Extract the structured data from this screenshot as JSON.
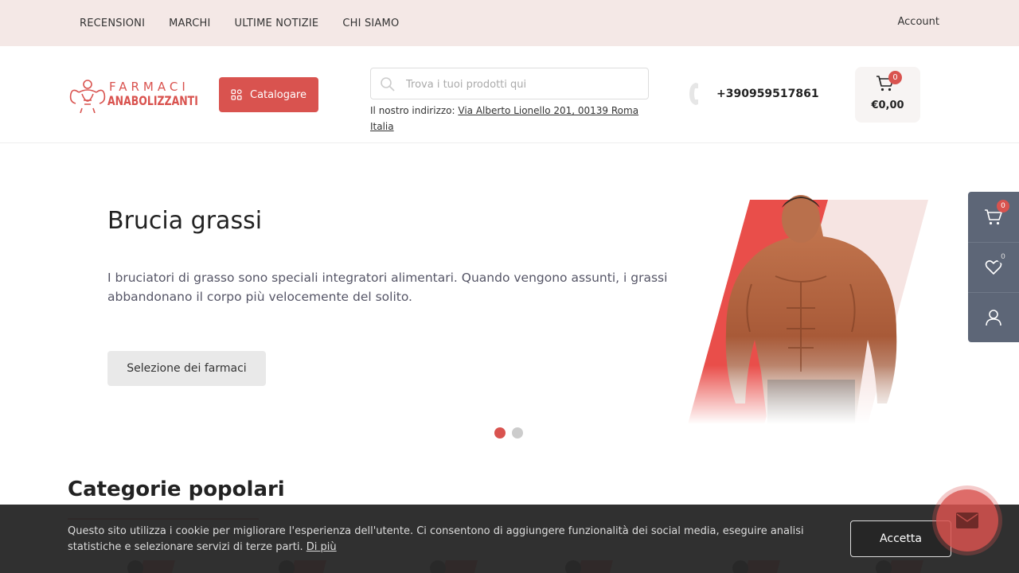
{
  "topnav": {
    "items": [
      "RECENSIONI",
      "MARCHI",
      "ULTIME NOTIZIE",
      "CHI SIAMO"
    ],
    "account": "Account"
  },
  "header": {
    "logo_line1": "FARMACI",
    "logo_line2": "ANABOLIZZANTI",
    "catalog_label": "Catalogare",
    "search_placeholder": "Trova i tuoi prodotti qui",
    "address_prefix": "Il nostro indirizzo:",
    "address_link": "Via Alberto Lionello 201, 00139 Roma Italia",
    "phone": "+390959517861",
    "cart_count": "0",
    "cart_total": "€0,00"
  },
  "hero": {
    "title": "Brucia grassi",
    "text": "I bruciatori di grasso sono speciali integratori alimentari. Quando vengono assunti, i grassi abbandonano il corpo più velocemente del solito.",
    "button": "Selezione dei farmaci",
    "slides": 2,
    "active_slide": 1
  },
  "sidepanel": {
    "cart_count": "0",
    "wishlist_count": "0"
  },
  "categories": {
    "title": "Categorie popolari"
  },
  "cookie": {
    "text": "Questo sito utilizza i cookie per migliorare l'esperienza dell'utente. Ci consentono di aggiungere funzionalità dei social media, eseguire analisi statistiche e selezionare servizi di terze parti.",
    "more_link": "Di più",
    "accept": "Accetta"
  },
  "colors": {
    "accent": "#d9534f",
    "topbar_bg": "#f4e8e6",
    "side_panel": "#5d6677",
    "cookie_bg": "#282828"
  },
  "icons": [
    "search-icon",
    "grid-icon",
    "phone-icon",
    "cart-icon",
    "heart-icon",
    "user-icon",
    "mail-icon"
  ]
}
